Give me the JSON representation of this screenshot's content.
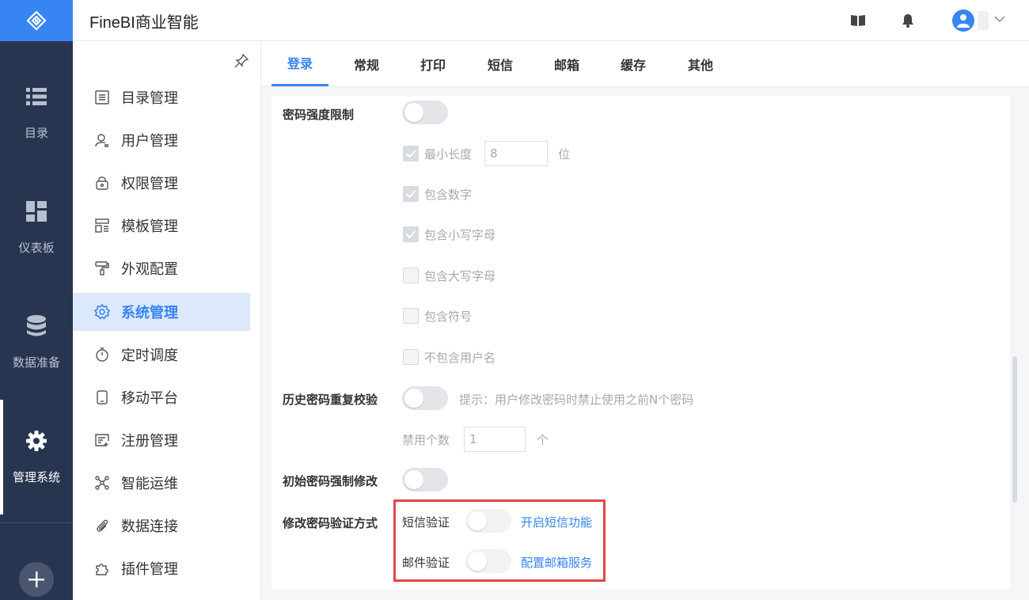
{
  "rail": {
    "items": [
      {
        "label": "目录",
        "icon": "list-icon"
      },
      {
        "label": "仪表板",
        "icon": "dashboard-icon"
      },
      {
        "label": "数据准备",
        "icon": "database-icon"
      },
      {
        "label": "管理系统",
        "icon": "gear-icon",
        "active": true
      }
    ]
  },
  "header": {
    "title": "FineBI商业智能"
  },
  "subnav": {
    "items": [
      {
        "label": "目录管理",
        "icon": "directory-icon"
      },
      {
        "label": "用户管理",
        "icon": "user-icon"
      },
      {
        "label": "权限管理",
        "icon": "lock-icon"
      },
      {
        "label": "模板管理",
        "icon": "template-icon"
      },
      {
        "label": "外观配置",
        "icon": "paint-roller-icon"
      },
      {
        "label": "系统管理",
        "icon": "gear-icon",
        "active": true
      },
      {
        "label": "定时调度",
        "icon": "stopwatch-icon"
      },
      {
        "label": "移动平台",
        "icon": "mobile-icon"
      },
      {
        "label": "注册管理",
        "icon": "register-icon"
      },
      {
        "label": "智能运维",
        "icon": "network-icon"
      },
      {
        "label": "数据连接",
        "icon": "paperclip-icon"
      },
      {
        "label": "插件管理",
        "icon": "puzzle-icon"
      }
    ]
  },
  "tabs": [
    "登录",
    "常规",
    "打印",
    "短信",
    "邮箱",
    "缓存",
    "其他"
  ],
  "active_tab": "登录",
  "settings": {
    "password_strength": {
      "label": "密码强度限制",
      "enabled": false,
      "min_length_label": "最小长度",
      "min_length_value": "8",
      "min_length_unit": "位",
      "options": [
        {
          "label": "包含数字",
          "checked": true
        },
        {
          "label": "包含小写字母",
          "checked": true
        },
        {
          "label": "包含大写字母",
          "checked": false
        },
        {
          "label": "包含符号",
          "checked": false
        },
        {
          "label": "不包含用户名",
          "checked": false
        }
      ]
    },
    "history_check": {
      "label": "历史密码重复校验",
      "enabled": false,
      "hint": "提示：用户修改密码时禁止使用之前N个密码",
      "count_label": "禁用个数",
      "count_value": "1",
      "count_unit": "个"
    },
    "initial_force_change": {
      "label": "初始密码强制修改",
      "enabled": false
    },
    "verify_method": {
      "label": "修改密码验证方式",
      "sms_label": "短信验证",
      "sms_link": "开启短信功能",
      "email_label": "邮件验证",
      "email_link": "配置邮箱服务"
    }
  },
  "colors": {
    "accent": "#3685f2",
    "rail_bg": "#283550",
    "highlight": "#e0484a"
  }
}
